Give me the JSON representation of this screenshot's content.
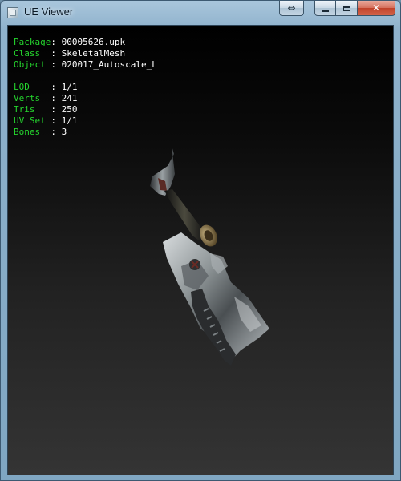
{
  "window": {
    "title": "UE Viewer",
    "icon": "app-icon",
    "buttons": {
      "swap": "⇔",
      "minimize": "minimize-icon",
      "maximize": "maximize-icon",
      "close": "✕"
    }
  },
  "info": {
    "object_block": [
      {
        "label": "Package",
        "sep": ": ",
        "value": "00005626.upk"
      },
      {
        "label": "Class  ",
        "sep": ": ",
        "value": "SkeletalMesh"
      },
      {
        "label": "Object ",
        "sep": ": ",
        "value": "020017_Autoscale_L"
      }
    ],
    "stats_block": [
      {
        "label": "LOD    ",
        "sep": ": ",
        "value": "1/1"
      },
      {
        "label": "Verts  ",
        "sep": ": ",
        "value": "241"
      },
      {
        "label": "Tris   ",
        "sep": ": ",
        "value": "250"
      },
      {
        "label": "UV Set ",
        "sep": ": ",
        "value": "1/1"
      },
      {
        "label": "Bones  ",
        "sep": ": ",
        "value": "3"
      }
    ],
    "label_color": "#25d52e",
    "value_color": "#ffffff"
  },
  "viewport": {
    "background_top": "#000000",
    "background_bottom": "#343434"
  }
}
